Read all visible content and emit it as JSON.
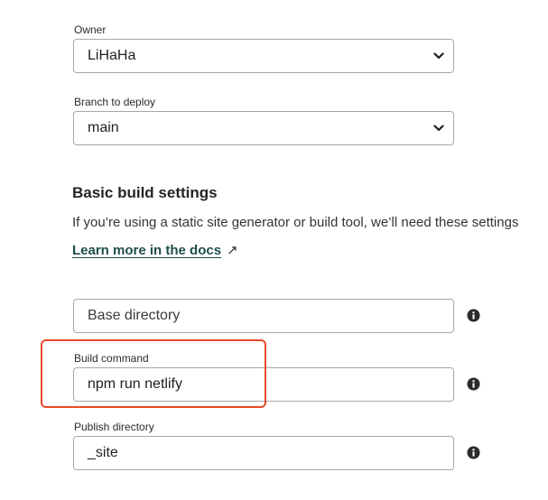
{
  "owner": {
    "label": "Owner",
    "value": "LiHaHa"
  },
  "branch": {
    "label": "Branch to deploy",
    "value": "main"
  },
  "build_settings": {
    "heading": "Basic build settings",
    "description": "If you’re using a static site generator or build tool, we’ll need these settings",
    "link_text": "Learn more in the docs",
    "link_arrow": "↗"
  },
  "base_directory": {
    "placeholder": "Base directory"
  },
  "build_command": {
    "label": "Build command",
    "value": "npm run netlify"
  },
  "publish_directory": {
    "label": "Publish directory",
    "value": "_site"
  },
  "colors": {
    "highlight": "#e8492a",
    "link": "#1e4d4a"
  },
  "icons": [
    "chevron-down-icon",
    "info-icon"
  ]
}
